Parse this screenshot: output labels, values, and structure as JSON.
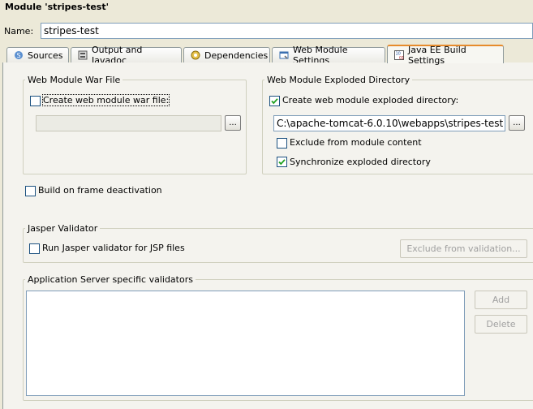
{
  "window": {
    "title": "Module 'stripes-test'"
  },
  "name_field": {
    "label": "Name:",
    "value": "stripes-test"
  },
  "tabs": [
    {
      "label": "Sources",
      "icon": "folder-icon"
    },
    {
      "label": "Output and Javadoc",
      "icon": "output-icon"
    },
    {
      "label": "Dependencies",
      "icon": "dependencies-icon"
    },
    {
      "label": "Web Module Settings",
      "icon": "web-module-icon"
    },
    {
      "label": "Java EE Build Settings",
      "icon": "build-settings-icon",
      "active": true
    }
  ],
  "war_group": {
    "title": "Web Module War File",
    "create_checkbox": {
      "label": "Create web module war file:",
      "checked": false
    },
    "path_value": "",
    "browse_label": "..."
  },
  "exploded_group": {
    "title": "Web Module Exploded Directory",
    "create_checkbox": {
      "label": "Create web module exploded directory:",
      "checked": true
    },
    "path_value": "C:\\apache-tomcat-6.0.10\\webapps\\stripes-test",
    "browse_label": "...",
    "exclude_checkbox": {
      "label": "Exclude from module content",
      "checked": false
    },
    "sync_checkbox": {
      "label": "Synchronize exploded directory",
      "checked": true
    }
  },
  "build_on_frame": {
    "label": "Build on frame deactivation",
    "checked": false
  },
  "jasper_group": {
    "title": "Jasper Validator",
    "run_checkbox": {
      "label": "Run Jasper validator for JSP files",
      "checked": false
    },
    "exclude_button": "Exclude from validation..."
  },
  "validators_group": {
    "title": "Application Server specific validators",
    "add_button": "Add",
    "delete_button": "Delete"
  },
  "colors": {
    "accent_tab": "#e68b2c",
    "checkbox_border": "#1c5180",
    "check_mark": "#21a121"
  }
}
